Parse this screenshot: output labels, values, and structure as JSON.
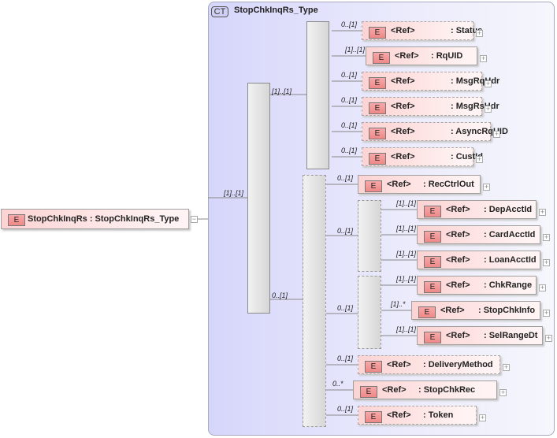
{
  "complex_type": {
    "badge": "CT",
    "name": "StopChkInqRs_Type"
  },
  "root": {
    "badge": "E",
    "label": "StopChkInqRs : StopChkInqRs_Type",
    "toggle": "−"
  },
  "connectors": {
    "root_to_seq": "[1]..[1]",
    "seq_to_top": "[1]..[1]",
    "seq_to_bottom": "0..[1]",
    "bottom_to_choice1": "0..[1]",
    "bottom_to_choice2": "0..[1]"
  },
  "elements": [
    {
      "badge": "E",
      "ref": "<Ref>",
      "name": ": Status",
      "card": "0..[1]",
      "toggle": "+"
    },
    {
      "badge": "E",
      "ref": "<Ref>",
      "name": ": RqUID",
      "card": "[1]..[1]",
      "toggle": "+"
    },
    {
      "badge": "E",
      "ref": "<Ref>",
      "name": ": MsgRqHdr",
      "card": "0..[1]",
      "toggle": "+"
    },
    {
      "badge": "E",
      "ref": "<Ref>",
      "name": ": MsgRsHdr",
      "card": "0..[1]",
      "toggle": "+"
    },
    {
      "badge": "E",
      "ref": "<Ref>",
      "name": ": AsyncRqUID",
      "card": "0..[1]",
      "toggle": "+"
    },
    {
      "badge": "E",
      "ref": "<Ref>",
      "name": ": CustId",
      "card": "0..[1]",
      "toggle": "+"
    },
    {
      "badge": "E",
      "ref": "<Ref>",
      "name": ": RecCtrlOut",
      "card": "0..[1]",
      "toggle": "+"
    },
    {
      "badge": "E",
      "ref": "<Ref>",
      "name": ": DepAcctId",
      "card": "[1]..[1]",
      "toggle": "+"
    },
    {
      "badge": "E",
      "ref": "<Ref>",
      "name": ": CardAcctId",
      "card": "[1]..[1]",
      "toggle": "+"
    },
    {
      "badge": "E",
      "ref": "<Ref>",
      "name": ": LoanAcctId",
      "card": "[1]..[1]",
      "toggle": "+"
    },
    {
      "badge": "E",
      "ref": "<Ref>",
      "name": ": ChkRange",
      "card": "[1]..[1]",
      "toggle": "+"
    },
    {
      "badge": "E",
      "ref": "<Ref>",
      "name": ": StopChkInfo",
      "card": "[1]..*",
      "toggle": "+"
    },
    {
      "badge": "E",
      "ref": "<Ref>",
      "name": ": SelRangeDt",
      "card": "[1]..[1]",
      "toggle": "+"
    },
    {
      "badge": "E",
      "ref": "<Ref>",
      "name": ": DeliveryMethod",
      "card": "0..[1]",
      "toggle": "+"
    },
    {
      "badge": "E",
      "ref": "<Ref>",
      "name": ": StopChkRec",
      "card": "0..*",
      "toggle": "+"
    },
    {
      "badge": "E",
      "ref": "<Ref>",
      "name": ": Token",
      "card": "0..[1]",
      "toggle": "+"
    }
  ]
}
